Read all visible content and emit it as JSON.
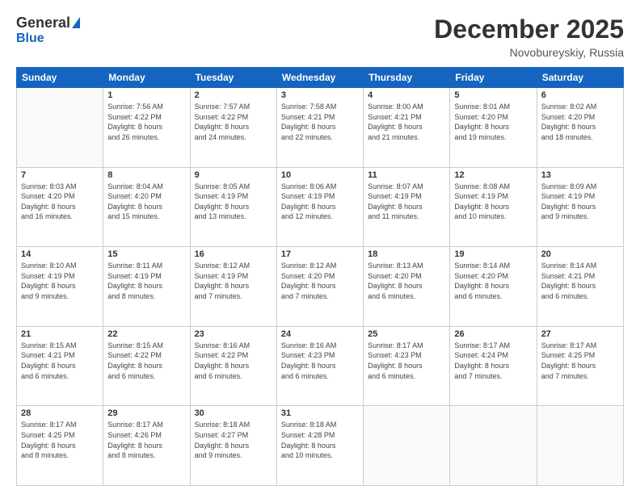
{
  "logo": {
    "general": "General",
    "blue": "Blue"
  },
  "header": {
    "month": "December 2025",
    "location": "Novobureyskiy, Russia"
  },
  "weekdays": [
    "Sunday",
    "Monday",
    "Tuesday",
    "Wednesday",
    "Thursday",
    "Friday",
    "Saturday"
  ],
  "weeks": [
    [
      {
        "day": "",
        "info": ""
      },
      {
        "day": "1",
        "info": "Sunrise: 7:56 AM\nSunset: 4:22 PM\nDaylight: 8 hours\nand 26 minutes."
      },
      {
        "day": "2",
        "info": "Sunrise: 7:57 AM\nSunset: 4:22 PM\nDaylight: 8 hours\nand 24 minutes."
      },
      {
        "day": "3",
        "info": "Sunrise: 7:58 AM\nSunset: 4:21 PM\nDaylight: 8 hours\nand 22 minutes."
      },
      {
        "day": "4",
        "info": "Sunrise: 8:00 AM\nSunset: 4:21 PM\nDaylight: 8 hours\nand 21 minutes."
      },
      {
        "day": "5",
        "info": "Sunrise: 8:01 AM\nSunset: 4:20 PM\nDaylight: 8 hours\nand 19 minutes."
      },
      {
        "day": "6",
        "info": "Sunrise: 8:02 AM\nSunset: 4:20 PM\nDaylight: 8 hours\nand 18 minutes."
      }
    ],
    [
      {
        "day": "7",
        "info": "Sunrise: 8:03 AM\nSunset: 4:20 PM\nDaylight: 8 hours\nand 16 minutes."
      },
      {
        "day": "8",
        "info": "Sunrise: 8:04 AM\nSunset: 4:20 PM\nDaylight: 8 hours\nand 15 minutes."
      },
      {
        "day": "9",
        "info": "Sunrise: 8:05 AM\nSunset: 4:19 PM\nDaylight: 8 hours\nand 13 minutes."
      },
      {
        "day": "10",
        "info": "Sunrise: 8:06 AM\nSunset: 4:19 PM\nDaylight: 8 hours\nand 12 minutes."
      },
      {
        "day": "11",
        "info": "Sunrise: 8:07 AM\nSunset: 4:19 PM\nDaylight: 8 hours\nand 11 minutes."
      },
      {
        "day": "12",
        "info": "Sunrise: 8:08 AM\nSunset: 4:19 PM\nDaylight: 8 hours\nand 10 minutes."
      },
      {
        "day": "13",
        "info": "Sunrise: 8:09 AM\nSunset: 4:19 PM\nDaylight: 8 hours\nand 9 minutes."
      }
    ],
    [
      {
        "day": "14",
        "info": "Sunrise: 8:10 AM\nSunset: 4:19 PM\nDaylight: 8 hours\nand 9 minutes."
      },
      {
        "day": "15",
        "info": "Sunrise: 8:11 AM\nSunset: 4:19 PM\nDaylight: 8 hours\nand 8 minutes."
      },
      {
        "day": "16",
        "info": "Sunrise: 8:12 AM\nSunset: 4:19 PM\nDaylight: 8 hours\nand 7 minutes."
      },
      {
        "day": "17",
        "info": "Sunrise: 8:12 AM\nSunset: 4:20 PM\nDaylight: 8 hours\nand 7 minutes."
      },
      {
        "day": "18",
        "info": "Sunrise: 8:13 AM\nSunset: 4:20 PM\nDaylight: 8 hours\nand 6 minutes."
      },
      {
        "day": "19",
        "info": "Sunrise: 8:14 AM\nSunset: 4:20 PM\nDaylight: 8 hours\nand 6 minutes."
      },
      {
        "day": "20",
        "info": "Sunrise: 8:14 AM\nSunset: 4:21 PM\nDaylight: 8 hours\nand 6 minutes."
      }
    ],
    [
      {
        "day": "21",
        "info": "Sunrise: 8:15 AM\nSunset: 4:21 PM\nDaylight: 8 hours\nand 6 minutes."
      },
      {
        "day": "22",
        "info": "Sunrise: 8:15 AM\nSunset: 4:22 PM\nDaylight: 8 hours\nand 6 minutes."
      },
      {
        "day": "23",
        "info": "Sunrise: 8:16 AM\nSunset: 4:22 PM\nDaylight: 8 hours\nand 6 minutes."
      },
      {
        "day": "24",
        "info": "Sunrise: 8:16 AM\nSunset: 4:23 PM\nDaylight: 8 hours\nand 6 minutes."
      },
      {
        "day": "25",
        "info": "Sunrise: 8:17 AM\nSunset: 4:23 PM\nDaylight: 8 hours\nand 6 minutes."
      },
      {
        "day": "26",
        "info": "Sunrise: 8:17 AM\nSunset: 4:24 PM\nDaylight: 8 hours\nand 7 minutes."
      },
      {
        "day": "27",
        "info": "Sunrise: 8:17 AM\nSunset: 4:25 PM\nDaylight: 8 hours\nand 7 minutes."
      }
    ],
    [
      {
        "day": "28",
        "info": "Sunrise: 8:17 AM\nSunset: 4:25 PM\nDaylight: 8 hours\nand 8 minutes."
      },
      {
        "day": "29",
        "info": "Sunrise: 8:17 AM\nSunset: 4:26 PM\nDaylight: 8 hours\nand 8 minutes."
      },
      {
        "day": "30",
        "info": "Sunrise: 8:18 AM\nSunset: 4:27 PM\nDaylight: 8 hours\nand 9 minutes."
      },
      {
        "day": "31",
        "info": "Sunrise: 8:18 AM\nSunset: 4:28 PM\nDaylight: 8 hours\nand 10 minutes."
      },
      {
        "day": "",
        "info": ""
      },
      {
        "day": "",
        "info": ""
      },
      {
        "day": "",
        "info": ""
      }
    ]
  ]
}
